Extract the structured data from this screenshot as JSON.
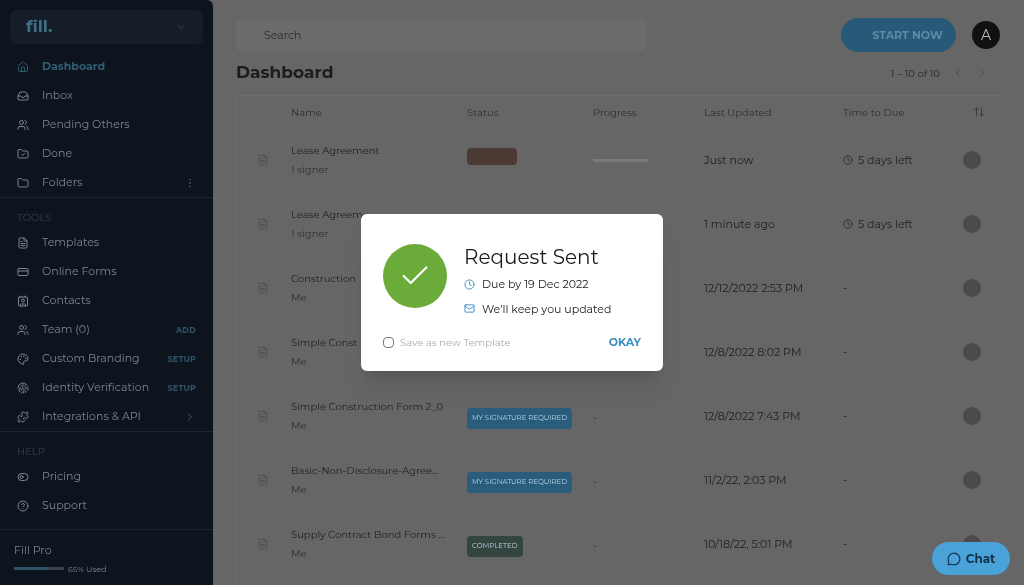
{
  "sidebar": {
    "logo": "fill.",
    "sections": [
      {
        "items": [
          {
            "label": "Dashboard",
            "selected": true
          },
          {
            "label": "Inbox",
            "selected": false
          },
          {
            "label": "Pending Others",
            "selected": false
          },
          {
            "label": "Done",
            "selected": false
          },
          {
            "label": "Folders",
            "selected": false,
            "kind": "more"
          }
        ]
      },
      {
        "heading": "TOOLS",
        "items": [
          {
            "label": "Templates",
            "selected": false
          },
          {
            "label": "Online Forms",
            "selected": false
          },
          {
            "label": "Contacts",
            "selected": false
          },
          {
            "label": "Team (0)",
            "selected": false,
            "action": "ADD"
          },
          {
            "label": "Custom Branding",
            "selected": false,
            "action": "SETUP"
          },
          {
            "label": "Identity Verification",
            "selected": false,
            "action": "SETUP"
          },
          {
            "label": "Integrations & API",
            "selected": false,
            "kind": "chevron"
          }
        ]
      },
      {
        "heading": "HELP",
        "items": [
          {
            "label": "Pricing",
            "selected": false
          },
          {
            "label": "Support",
            "selected": false
          }
        ]
      }
    ],
    "plan": {
      "name": "Fill Pro",
      "level": 0.65,
      "usage": "65% Used"
    }
  },
  "search": {
    "placeholder": "Search"
  },
  "start_button": "START NOW",
  "avatar": "A",
  "title": "Dashboard",
  "pagination": "1 – 10 of 10",
  "table": {
    "columns": [
      "Name",
      "Status",
      "Progress",
      "Last Updated",
      "Time to Due"
    ],
    "rows": [
      {
        "name": "Lease Agreement",
        "sub": "1 signer",
        "status": {
          "color": "#4a3a33"
        },
        "progress": {
          "level": 0
        },
        "updated": "Just now",
        "due": "5 days left"
      },
      {
        "name": "Lease Agreem",
        "sub": "1 signer",
        "updated": "1 minute ago",
        "due": "5 days left"
      },
      {
        "name": "Construction",
        "sub": "Me",
        "updated": "12/12/2022 2:53 PM",
        "due": "-"
      },
      {
        "name": "Simple Const",
        "sub": "Me",
        "updated": "12/8/2022 8:02 PM",
        "due": "-"
      },
      {
        "name": "Simple Construction Form 2_0",
        "sub": "Me",
        "status": {
          "label": "MY SIGNATURE REQUIRED",
          "color": "#2a5d7c"
        },
        "progress": {
          "text": "-"
        },
        "updated": "12/8/2022 7:43 PM",
        "due": "-"
      },
      {
        "name": "Basic-Non-Disclosure-Agree...",
        "sub": "Me",
        "status": {
          "label": "MY SIGNATURE REQUIRED",
          "color": "#2a5d7c"
        },
        "progress": {
          "text": "-"
        },
        "updated": "11/2/22, 2:03 PM",
        "due": "-"
      },
      {
        "name": "Supply Contract Bond Forms ...",
        "sub": "Me",
        "status": {
          "label": "COMPLETED",
          "color": "#34443f"
        },
        "progress": {
          "text": "-"
        },
        "updated": "10/18/22, 5:01 PM",
        "due": "-"
      }
    ]
  },
  "dialog": {
    "title": "Request Sent",
    "due": "Due by 19 Dec 2022",
    "note": "We’ll keep you updated",
    "save_template": {
      "label": "Save as new Template",
      "checked": false
    },
    "ok": "OKAY"
  },
  "chat": "Chat"
}
